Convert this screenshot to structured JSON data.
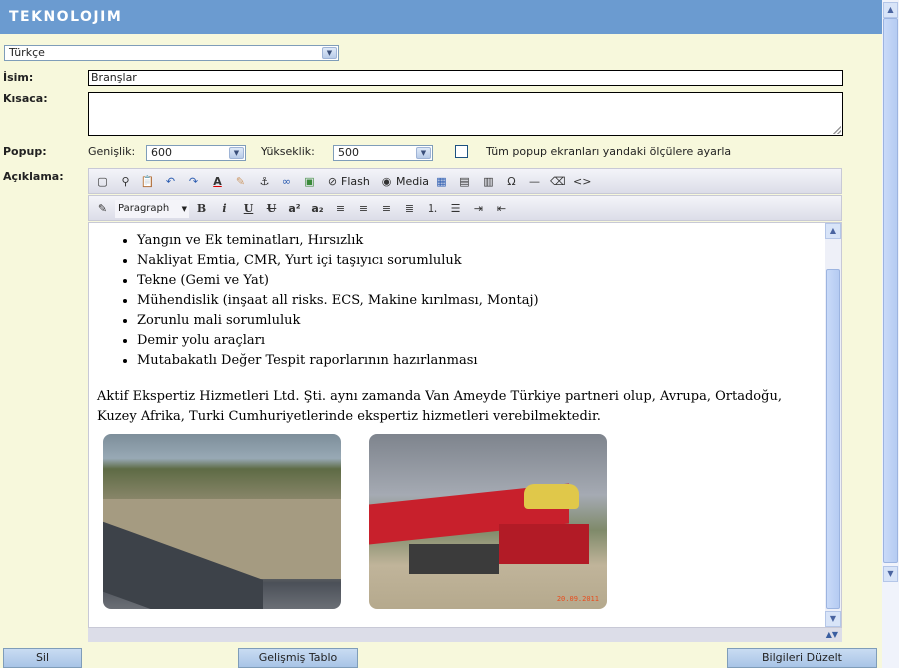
{
  "header": {
    "logo": "TEKNOLOJIM"
  },
  "language_select": {
    "value": "Türkçe"
  },
  "fields": {
    "name_label": "İsim:",
    "name_value": "Branşlar",
    "short_label": "Kısaca:",
    "popup_label": "Popup:",
    "width_label": "Genişlik:",
    "width_value": "600",
    "height_label": "Yükseklik:",
    "height_value": "500",
    "popup_checkbox_label": "Tüm popup ekranları yandaki ölçülere ayarla",
    "description_label": "Açıklama:"
  },
  "toolbar": {
    "flash": "Flash",
    "media": "Media",
    "format_select": "Paragraph",
    "bold": "B",
    "italic": "i",
    "underline": "U",
    "strike": "U",
    "superscript": "a²",
    "subscript": "a₂"
  },
  "editor": {
    "list_items": [
      "Yangın ve Ek teminatları, Hırsızlık",
      "Nakliyat Emtia, CMR, Yurt içi taşıyıcı sorumluluk",
      "Tekne (Gemi ve Yat)",
      "Mühendislik (inşaat all risks. ECS, Makine kırılması, Montaj)",
      "Zorunlu mali sorumluluk",
      "Demir yolu araçları",
      "Mutabakatlı Değer Tespit raporlarının hazırlanması"
    ],
    "paragraph": "Aktif Ekspertiz Hizmetleri Ltd. Şti. aynı zamanda Van Ameyde Türkiye partneri olup, Avrupa, Ortadoğu, Kuzey Afrika, Turki Cumhuriyetlerinde ekspertiz hizmetleri verebilmektedir.",
    "photo_stamp": "20.09.2011"
  },
  "buttons": {
    "delete": "Sil",
    "advanced_table": "Gelişmiş Tablo",
    "update": "Bilgileri Düzelt"
  }
}
